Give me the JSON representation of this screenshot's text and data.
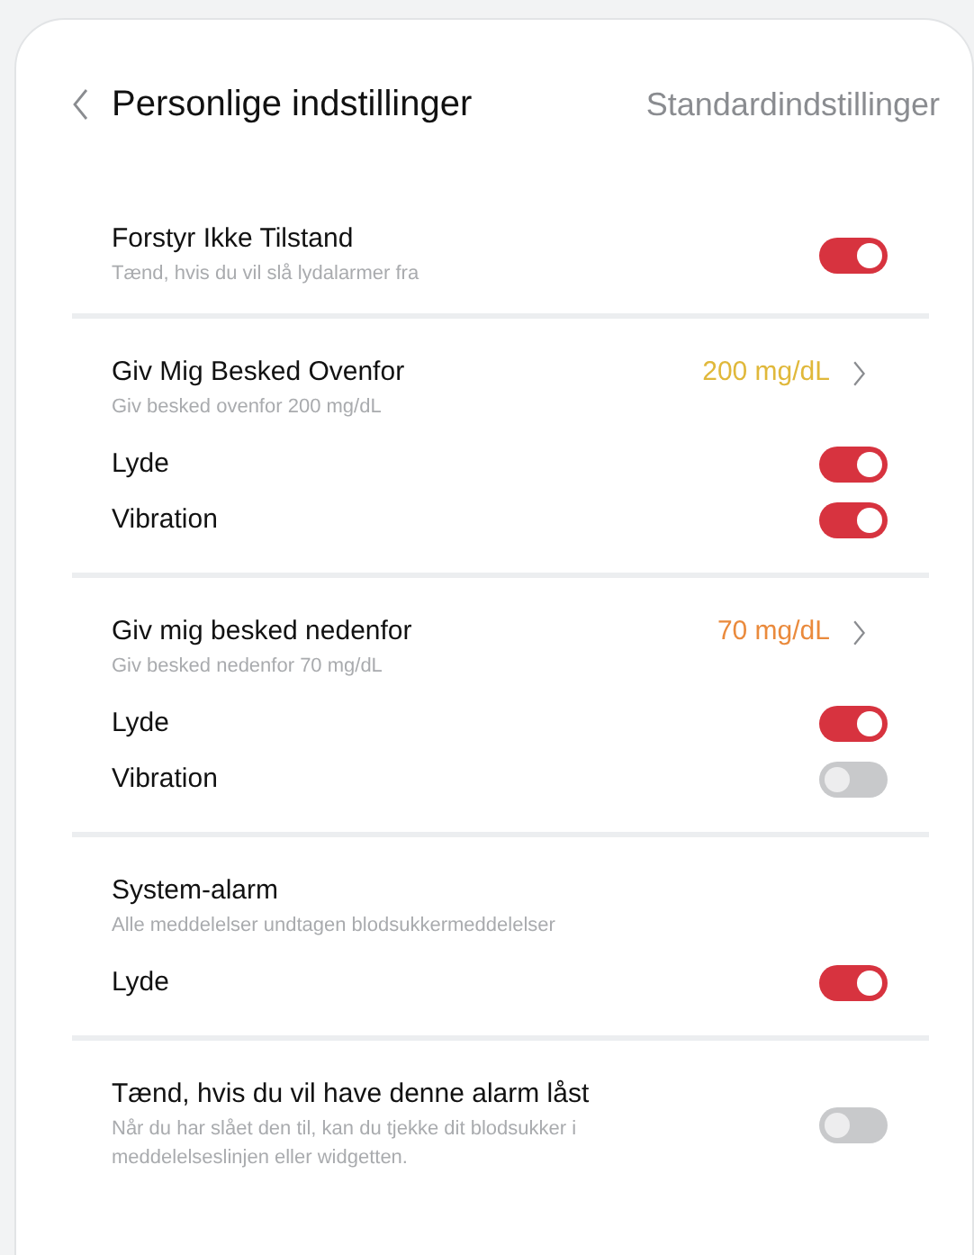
{
  "header": {
    "title": "Personlige indstillinger",
    "action": "Standardindstillinger"
  },
  "sections": [
    {
      "title": "Forstyr Ikke Tilstand",
      "subtitle": "Tænd, hvis du vil slå lydalarmer fra",
      "toggle": {
        "on": true
      }
    },
    {
      "title": "Giv Mig Besked Ovenfor",
      "subtitle": "Giv besked ovenfor 200 mg/dL",
      "value": "200 mg/dL",
      "color": "#e0b83a",
      "rows": [
        {
          "label": "Lyde",
          "on": true
        },
        {
          "label": "Vibration",
          "on": true
        }
      ]
    },
    {
      "title": "Giv mig besked nedenfor",
      "subtitle": "Giv besked nedenfor 70 mg/dL",
      "value": "70 mg/dL",
      "color": "#ea8a3c",
      "rows": [
        {
          "label": "Lyde",
          "on": true
        },
        {
          "label": "Vibration",
          "on": false
        }
      ]
    },
    {
      "title": "System-alarm",
      "subtitle": "Alle meddelelser undtagen blodsukkermeddelelser",
      "rows": [
        {
          "label": "Lyde",
          "on": true
        }
      ]
    },
    {
      "title": "Tænd, hvis du vil have denne alarm låst",
      "subtitle": "Når du har slået den til, kan du tjekke dit blodsukker i meddelelseslinjen eller widgetten.",
      "toggle": {
        "on": false
      }
    }
  ]
}
